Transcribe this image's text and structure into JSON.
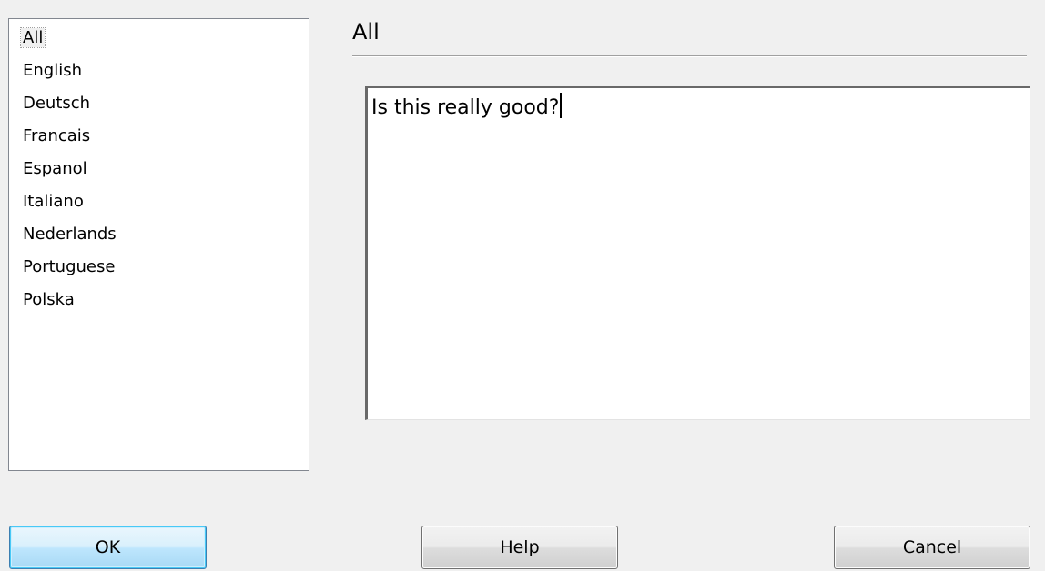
{
  "languages": {
    "items": [
      {
        "label": "All",
        "selected": true
      },
      {
        "label": "English",
        "selected": false
      },
      {
        "label": "Deutsch",
        "selected": false
      },
      {
        "label": "Francais",
        "selected": false
      },
      {
        "label": "Espanol",
        "selected": false
      },
      {
        "label": "Italiano",
        "selected": false
      },
      {
        "label": "Nederlands",
        "selected": false
      },
      {
        "label": "Portuguese",
        "selected": false
      },
      {
        "label": "Polska",
        "selected": false
      }
    ]
  },
  "header": {
    "title": "All"
  },
  "editor": {
    "text": "Is this really good?"
  },
  "buttons": {
    "ok_label": "OK",
    "help_label": "Help",
    "cancel_label": "Cancel"
  },
  "colors": {
    "background": "#f0f0f0",
    "default_button": "#bee6fd",
    "border": "#828790"
  }
}
